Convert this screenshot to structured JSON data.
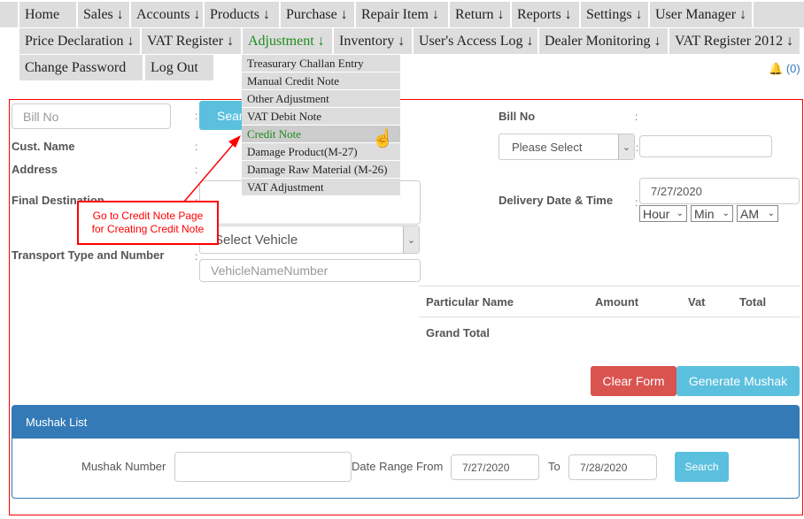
{
  "nav": {
    "row1": [
      "Home",
      "Sales ↓",
      "Accounts ↓",
      "Products ↓",
      "Purchase ↓",
      "Repair Item ↓",
      "Return ↓",
      "Reports ↓",
      "Settings ↓",
      "User Manager ↓"
    ],
    "row2": [
      "Price Declaration ↓",
      "VAT Register ↓",
      "Adjustment ↓",
      "Inventory ↓",
      "User's Access Log ↓",
      "Dealer Monitoring ↓",
      "VAT Register 2012 ↓"
    ],
    "row3": [
      "Change Password",
      "Log Out"
    ]
  },
  "dropdown": [
    "Treasurary Challan Entry",
    "Manual Credit Note",
    "Other Adjustment",
    "VAT Debit Note",
    "Credit Note",
    "Damage Product(M-27)",
    "Damage Raw Material (M-26)",
    "VAT Adjustment"
  ],
  "notification": {
    "icon": "bell-icon",
    "count": "(0)"
  },
  "form": {
    "bill_no_placeholder": "Bill No",
    "search_label": "Search",
    "cust_name": "Cust. Name",
    "address": "Address",
    "final_destination": "Final Destination",
    "transport": "Transport Type and Number",
    "vehicle_select": "Select Vehicle",
    "vehicle_placeholder": "VehicleNameNumber",
    "bill_no_label": "Bill No",
    "please_select": "Please Select",
    "delivery_label": "Delivery Date & Time",
    "delivery_date": "7/27/2020",
    "hour": "Hour",
    "min": "Min",
    "ampm": "AM",
    "colon": ":"
  },
  "table": {
    "headers": [
      "Particular Name",
      "Amount",
      "Vat",
      "Total"
    ],
    "grand_total": "Grand Total"
  },
  "buttons": {
    "clear": "Clear Form",
    "generate": "Generate Mushak"
  },
  "callout": {
    "line1": "Go to Credit Note Page",
    "line2": "for Creating Credit Note"
  },
  "mushak": {
    "title": "Mushak List",
    "number_label": "Mushak Number",
    "range_from": "Date Range From",
    "from": "7/27/2020",
    "to_label": "To",
    "to": "7/28/2020",
    "search": "Search"
  },
  "colors": {
    "accent_green": "#1e8a1e",
    "danger": "#d9534f",
    "info": "#5bc0de",
    "primary": "#337ab7",
    "annotation": "#ff0000"
  }
}
